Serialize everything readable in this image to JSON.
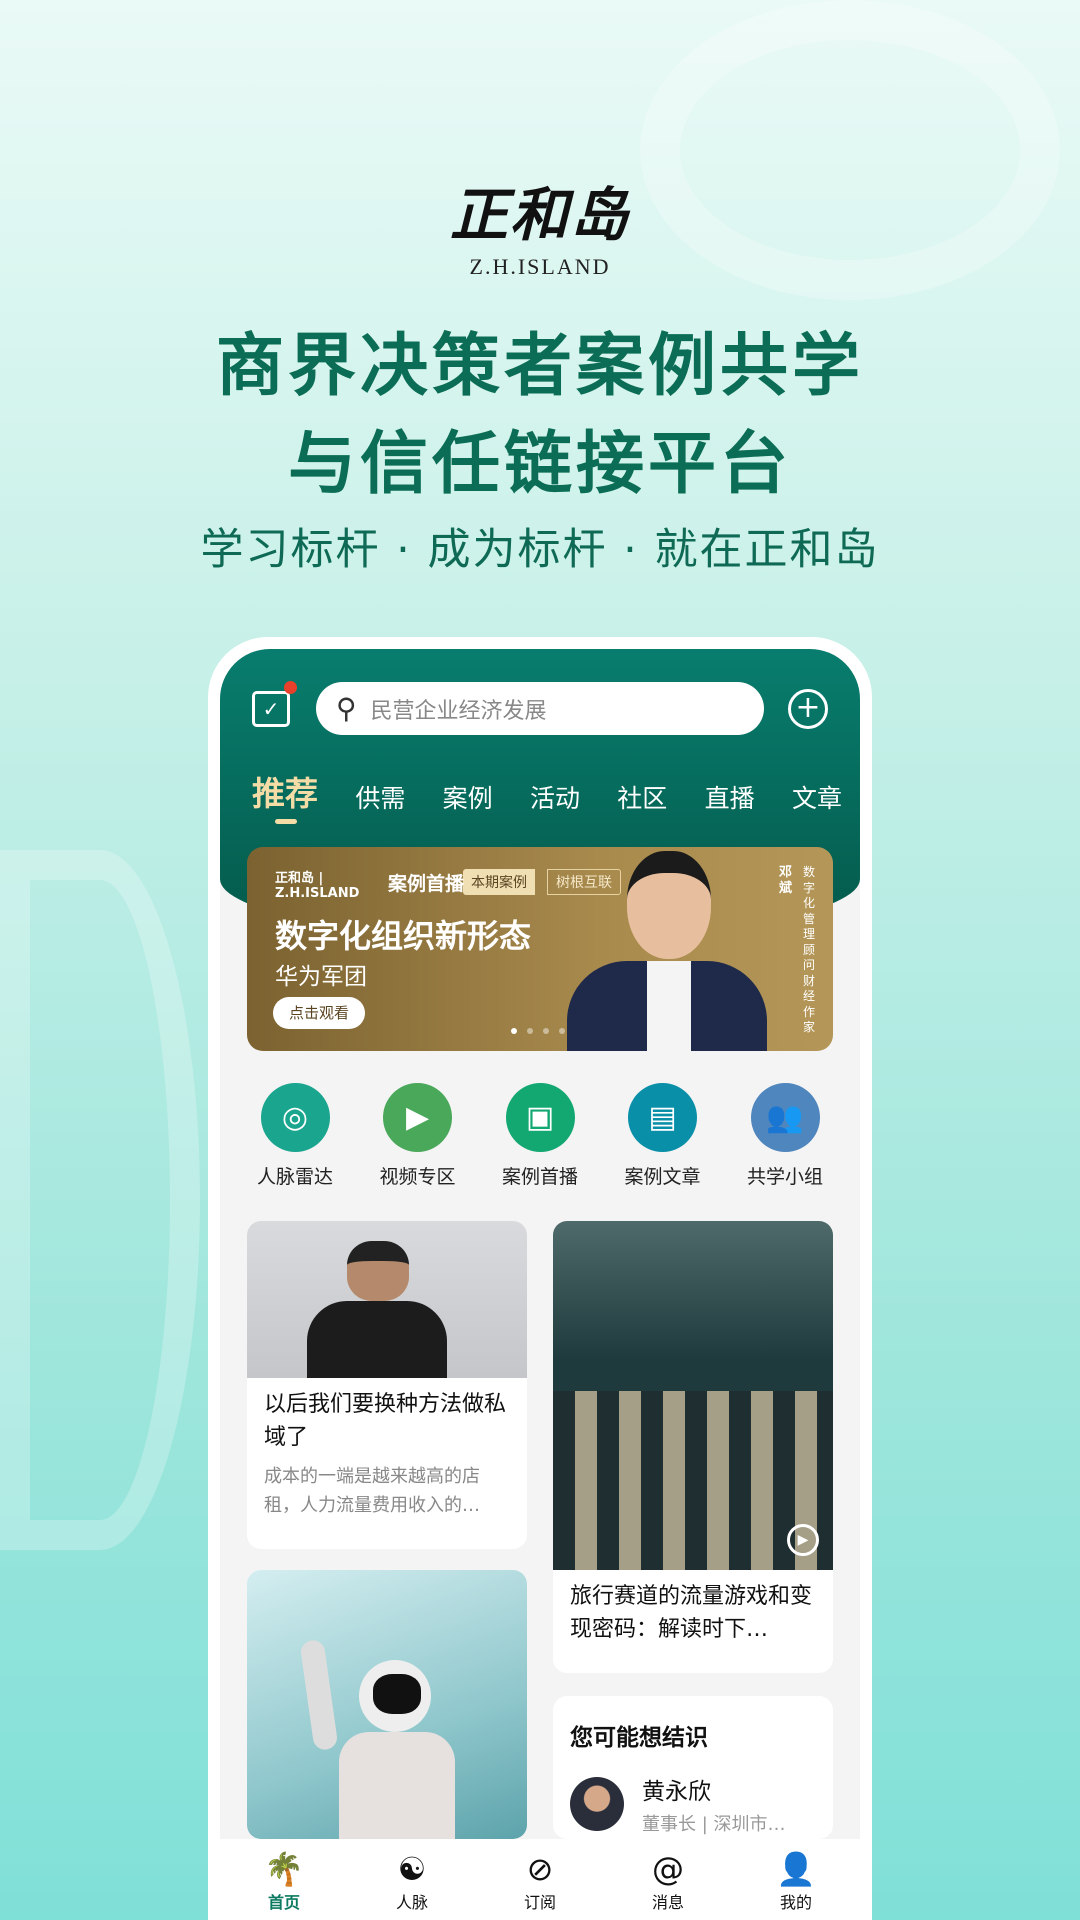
{
  "brand": {
    "logo_cn": "正和岛",
    "logo_en": "Z.H.ISLAND"
  },
  "headline": {
    "line1": "商界决策者案例共学",
    "line2": "与信任链接平台",
    "subtitle": "学习标杆 · 成为标杆 · 就在正和岛"
  },
  "app": {
    "search": {
      "placeholder": "民营企业经济发展"
    },
    "tabs": [
      {
        "label": "推荐",
        "active": true
      },
      {
        "label": "供需"
      },
      {
        "label": "案例"
      },
      {
        "label": "活动"
      },
      {
        "label": "社区"
      },
      {
        "label": "直播"
      },
      {
        "label": "文章"
      }
    ],
    "banner": {
      "brand": "正和岛 | Z.H.ISLAND",
      "series": "案例首播",
      "tag_current": "本期案例",
      "tag_company": "树根互联",
      "title": "数字化组织新形态",
      "subtitle": "华为军团",
      "button": "点击观看",
      "speaker_name": "邓斌",
      "speaker_desc": "数字化管理顾问财经作家",
      "page_index": 1,
      "page_count": 4
    },
    "entries": [
      {
        "label": "人脉雷达",
        "icon": "radar-icon",
        "color": "#1aa58f"
      },
      {
        "label": "视频专区",
        "icon": "video-camera-icon",
        "color": "#4aa85a"
      },
      {
        "label": "案例首播",
        "icon": "clapper-play-icon",
        "color": "#13a872"
      },
      {
        "label": "案例文章",
        "icon": "document-icon",
        "color": "#0a8fa8"
      },
      {
        "label": "共学小组",
        "icon": "group-icon",
        "color": "#4f86bd"
      }
    ],
    "feed": [
      {
        "title": "以后我们要换种方法做私域了",
        "desc": "成本的一端是越来越高的店租，人力流量费用收入的…"
      },
      {
        "title": "旅行赛道的流量游戏和变现密码：解读时下…",
        "video": true
      }
    ],
    "know": {
      "heading": "您可能想结识",
      "person": {
        "name": "黄永欣",
        "role": "董事长 | 深圳市…"
      }
    },
    "nav": [
      {
        "label": "首页",
        "icon": "island-icon",
        "active": true
      },
      {
        "label": "人脉",
        "icon": "fish-icon"
      },
      {
        "label": "订阅",
        "icon": "compass-icon"
      },
      {
        "label": "消息",
        "icon": "shell-icon"
      },
      {
        "label": "我的",
        "icon": "person-icon"
      }
    ]
  }
}
